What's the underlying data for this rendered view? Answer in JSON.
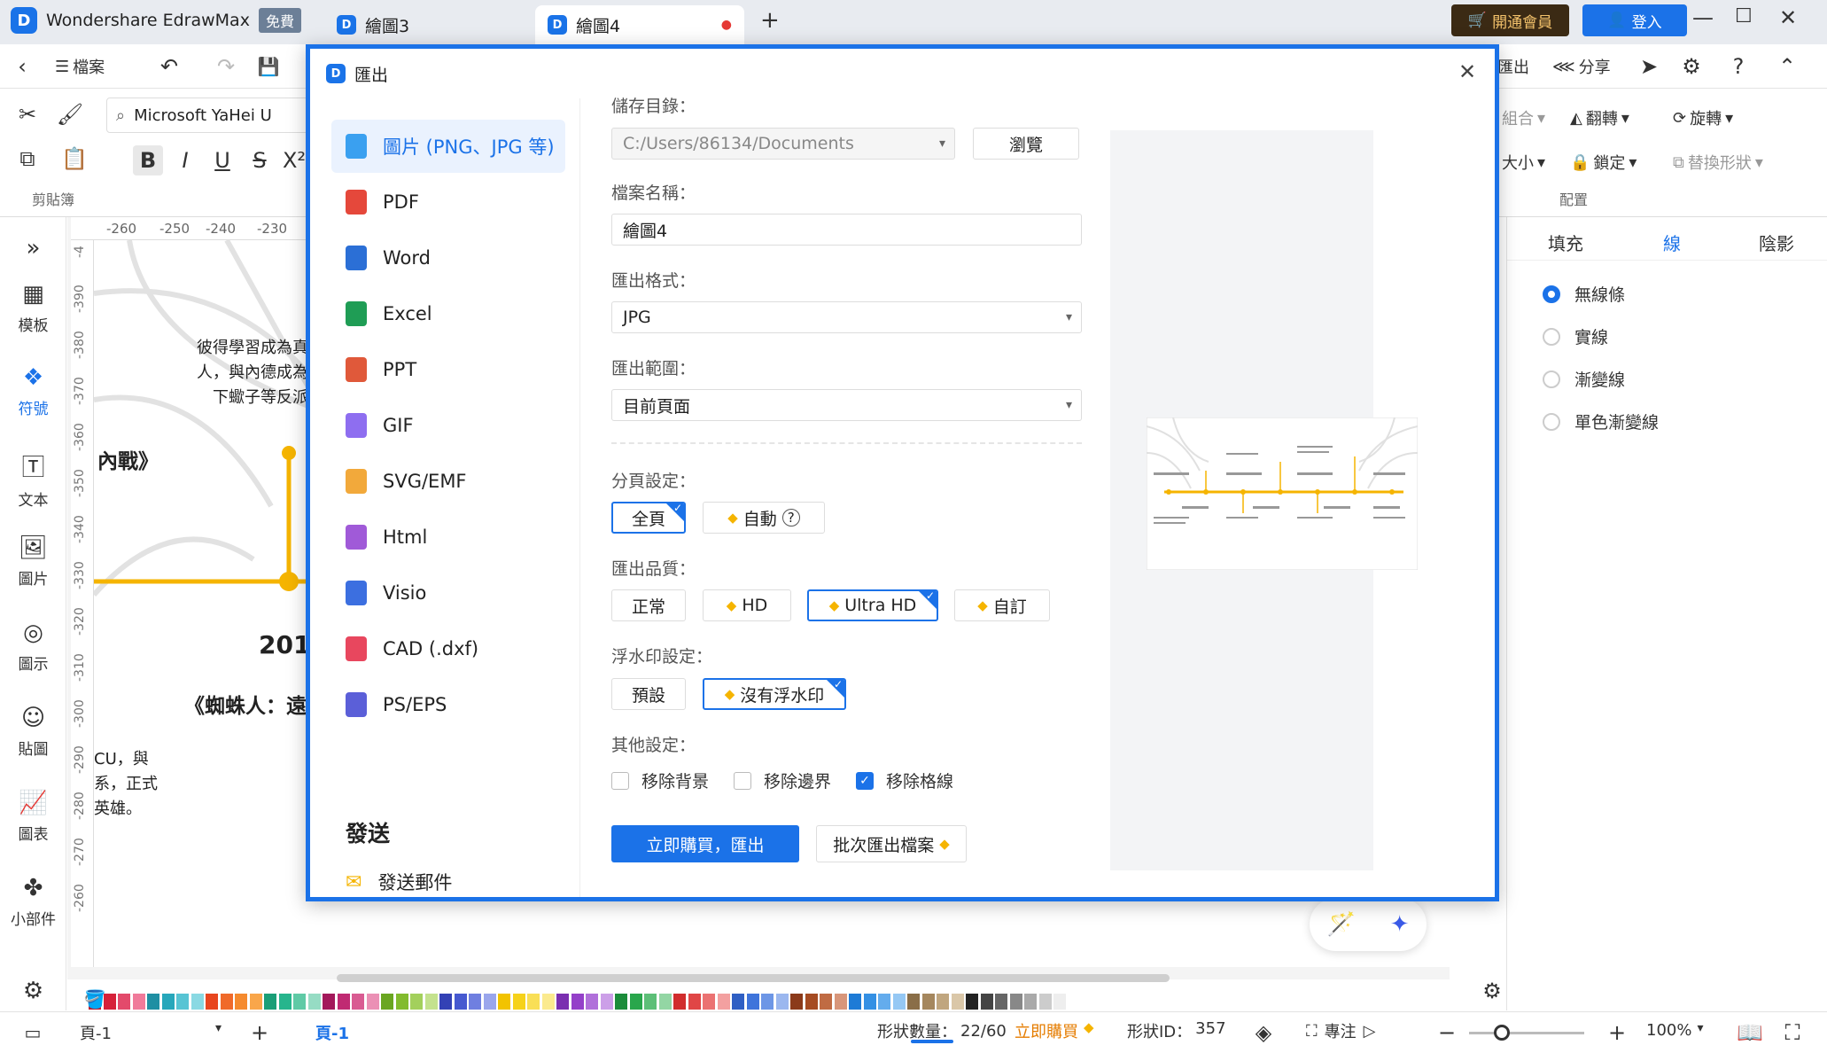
{
  "titlebar": {
    "app_name": "Wondershare EdrawMax",
    "free_badge": "免費",
    "tabs": [
      {
        "label": "繪圖3"
      },
      {
        "label": "繪圖4"
      }
    ],
    "member_button": "開通會員",
    "login_button": "登入"
  },
  "menubar": {
    "file_label": "檔案",
    "export_label": "匯出",
    "share_label": "分享"
  },
  "ribbon": {
    "font_name": "Microsoft YaHei U",
    "clipboard_group": "剪貼簿",
    "group_label": "組合",
    "flip_label": "翻轉",
    "rotate_label": "旋轉",
    "size_label": "大小",
    "lock_label": "鎖定",
    "replace_label": "替換形狀",
    "arrange_group": "配置"
  },
  "leftbar": {
    "items": [
      {
        "label": "模板"
      },
      {
        "label": "符號"
      },
      {
        "label": "文本"
      },
      {
        "label": "圖片"
      },
      {
        "label": "圖示"
      },
      {
        "label": "貼圖"
      },
      {
        "label": "圖表"
      },
      {
        "label": "小部件"
      }
    ]
  },
  "ruler": {
    "h_ticks": [
      "-260",
      "-250",
      "-240",
      "-230"
    ],
    "v_ticks": [
      "-4",
      "-390",
      "-380",
      "-370",
      "-360",
      "-350",
      "-340",
      "-330",
      "-320",
      "-310",
      "-300",
      "-290",
      "-280",
      "-270",
      "-260"
    ]
  },
  "canvas": {
    "text1": "彼得學習成為真",
    "text2": "人，與內德成為",
    "text3": "下蠍子等反派",
    "text4": "內戰》",
    "text5": "201",
    "text6": "《蜘蛛人：遠",
    "text7": "CU，與",
    "text8": "系，正式",
    "text9": "英雄。"
  },
  "rightpanel": {
    "tabs": [
      "填充",
      "線",
      "陰影"
    ],
    "line_options": [
      "無線條",
      "實線",
      "漸變線",
      "單色漸變線"
    ],
    "selected_option": 0
  },
  "dialog": {
    "title": "匯出",
    "formats": [
      {
        "label": "圖片 (PNG、JPG 等)",
        "icon": "image-file-icon",
        "color": "#3aa0f0"
      },
      {
        "label": "PDF",
        "icon": "pdf-file-icon",
        "color": "#e5483b"
      },
      {
        "label": "Word",
        "icon": "word-file-icon",
        "color": "#2b6fd6"
      },
      {
        "label": "Excel",
        "icon": "excel-file-icon",
        "color": "#1f9d55"
      },
      {
        "label": "PPT",
        "icon": "ppt-file-icon",
        "color": "#e0593a"
      },
      {
        "label": "GIF",
        "icon": "gif-file-icon",
        "color": "#8e6ef0"
      },
      {
        "label": "SVG/EMF",
        "icon": "svg-file-icon",
        "color": "#f2a93b"
      },
      {
        "label": "Html",
        "icon": "html-file-icon",
        "color": "#a05ad8"
      },
      {
        "label": "Visio",
        "icon": "visio-file-icon",
        "color": "#3c6fe0"
      },
      {
        "label": "CAD (.dxf)",
        "icon": "cad-file-icon",
        "color": "#e8475e"
      },
      {
        "label": "PS/EPS",
        "icon": "ps-file-icon",
        "color": "#5b5fd8"
      }
    ],
    "send_heading": "發送",
    "send_email": "發送郵件",
    "save_dir_label": "儲存目錄：",
    "save_dir_value": "C:/Users/86134/Documents",
    "browse_button": "瀏覽",
    "filename_label": "檔案名稱：",
    "filename_value": "繪圖4",
    "format_label": "匯出格式：",
    "format_value": "JPG",
    "range_label": "匯出範圍：",
    "range_value": "目前頁面",
    "paging_label": "分頁設定：",
    "paging_options": [
      "全頁",
      "自動"
    ],
    "quality_label": "匯出品質：",
    "quality_options": [
      "正常",
      "HD",
      "Ultra HD",
      "自訂"
    ],
    "watermark_label": "浮水印設定：",
    "watermark_options": [
      "預設",
      "沒有浮水印"
    ],
    "other_label": "其他設定：",
    "other_options": [
      {
        "label": "移除背景",
        "checked": false
      },
      {
        "label": "移除邊界",
        "checked": false
      },
      {
        "label": "移除格線",
        "checked": true
      }
    ],
    "buy_export_button": "立即購買，匯出",
    "batch_export_button": "批次匯出檔案"
  },
  "statusbar": {
    "page_select": "頁-1",
    "page_tab": "頁-1",
    "shape_count_label": "形狀數量：",
    "shape_count": "22/60",
    "buy_now": "立即購買",
    "shape_id_label": "形狀ID：",
    "shape_id": "357",
    "focus_label": "專注",
    "zoom": "100%"
  },
  "colors": {
    "accent": "#1b72e8",
    "member_bg": "#3b2a14",
    "member_text": "#f3c26b",
    "timeline": "#f5b400"
  }
}
